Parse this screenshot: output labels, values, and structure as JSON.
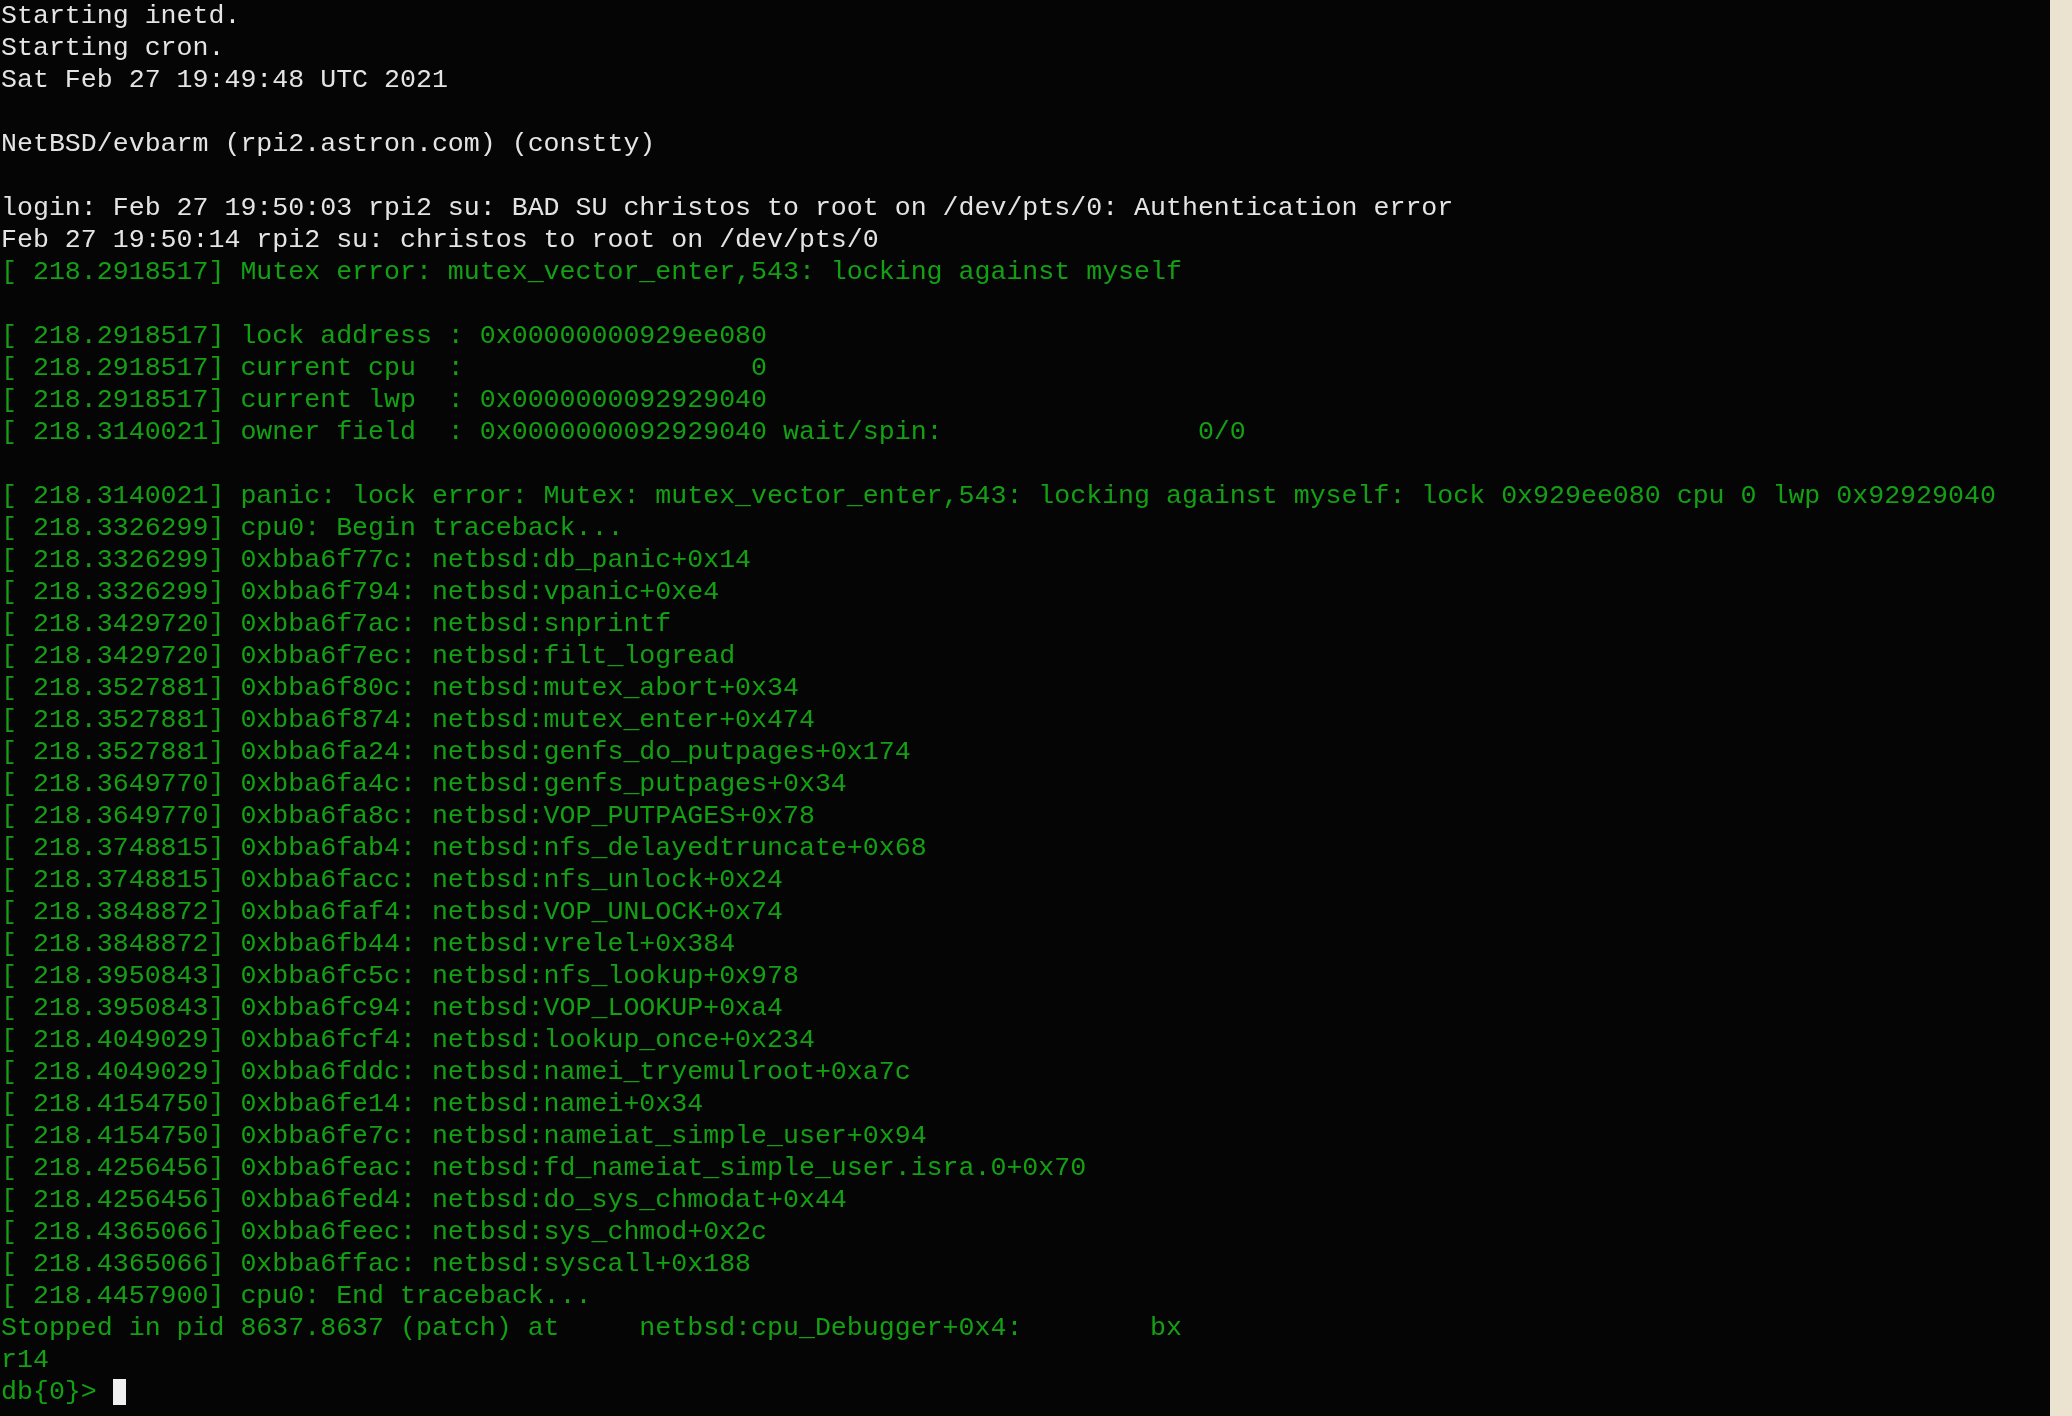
{
  "console": {
    "blocks": [
      {
        "lines": [
          {
            "kind": "system",
            "text": "Starting inetd."
          },
          {
            "kind": "system",
            "text": "Starting cron."
          },
          {
            "kind": "system",
            "text": "Sat Feb 27 19:49:48 UTC 2021"
          }
        ]
      },
      {
        "lines": [
          {
            "kind": "system",
            "text": "NetBSD/evbarm (rpi2.astron.com) (constty)"
          }
        ]
      },
      {
        "lines": [
          {
            "kind": "system",
            "text": "login: Feb 27 19:50:03 rpi2 su: BAD SU christos to root on /dev/pts/0: Authentication error"
          },
          {
            "kind": "system",
            "text": "Feb 27 19:50:14 rpi2 su: christos to root on /dev/pts/0"
          },
          {
            "kind": "kernel",
            "text": "[ 218.2918517] Mutex error: mutex_vector_enter,543: locking against myself"
          }
        ]
      },
      {
        "lines": [
          {
            "kind": "kernel",
            "text": "[ 218.2918517] lock address : 0x00000000929ee080"
          },
          {
            "kind": "kernel",
            "text": "[ 218.2918517] current cpu  :                  0"
          },
          {
            "kind": "kernel",
            "text": "[ 218.2918517] current lwp  : 0x0000000092929040"
          },
          {
            "kind": "kernel",
            "text": "[ 218.3140021] owner field  : 0x0000000092929040 wait/spin:                0/0"
          }
        ]
      },
      {
        "lines": [
          {
            "kind": "kernel",
            "text": "[ 218.3140021] panic: lock error: Mutex: mutex_vector_enter,543: locking against myself: lock 0x929ee080 cpu 0 lwp 0x92929040"
          },
          {
            "kind": "kernel",
            "text": "[ 218.3326299] cpu0: Begin traceback..."
          },
          {
            "kind": "kernel",
            "text": "[ 218.3326299] 0xbba6f77c: netbsd:db_panic+0x14"
          },
          {
            "kind": "kernel",
            "text": "[ 218.3326299] 0xbba6f794: netbsd:vpanic+0xe4"
          },
          {
            "kind": "kernel",
            "text": "[ 218.3429720] 0xbba6f7ac: netbsd:snprintf"
          },
          {
            "kind": "kernel",
            "text": "[ 218.3429720] 0xbba6f7ec: netbsd:filt_logread"
          },
          {
            "kind": "kernel",
            "text": "[ 218.3527881] 0xbba6f80c: netbsd:mutex_abort+0x34"
          },
          {
            "kind": "kernel",
            "text": "[ 218.3527881] 0xbba6f874: netbsd:mutex_enter+0x474"
          },
          {
            "kind": "kernel",
            "text": "[ 218.3527881] 0xbba6fa24: netbsd:genfs_do_putpages+0x174"
          },
          {
            "kind": "kernel",
            "text": "[ 218.3649770] 0xbba6fa4c: netbsd:genfs_putpages+0x34"
          },
          {
            "kind": "kernel",
            "text": "[ 218.3649770] 0xbba6fa8c: netbsd:VOP_PUTPAGES+0x78"
          },
          {
            "kind": "kernel",
            "text": "[ 218.3748815] 0xbba6fab4: netbsd:nfs_delayedtruncate+0x68"
          },
          {
            "kind": "kernel",
            "text": "[ 218.3748815] 0xbba6facc: netbsd:nfs_unlock+0x24"
          },
          {
            "kind": "kernel",
            "text": "[ 218.3848872] 0xbba6faf4: netbsd:VOP_UNLOCK+0x74"
          },
          {
            "kind": "kernel",
            "text": "[ 218.3848872] 0xbba6fb44: netbsd:vrelel+0x384"
          },
          {
            "kind": "kernel",
            "text": "[ 218.3950843] 0xbba6fc5c: netbsd:nfs_lookup+0x978"
          },
          {
            "kind": "kernel",
            "text": "[ 218.3950843] 0xbba6fc94: netbsd:VOP_LOOKUP+0xa4"
          },
          {
            "kind": "kernel",
            "text": "[ 218.4049029] 0xbba6fcf4: netbsd:lookup_once+0x234"
          },
          {
            "kind": "kernel",
            "text": "[ 218.4049029] 0xbba6fddc: netbsd:namei_tryemulroot+0xa7c"
          },
          {
            "kind": "kernel",
            "text": "[ 218.4154750] 0xbba6fe14: netbsd:namei+0x34"
          },
          {
            "kind": "kernel",
            "text": "[ 218.4154750] 0xbba6fe7c: netbsd:nameiat_simple_user+0x94"
          },
          {
            "kind": "kernel",
            "text": "[ 218.4256456] 0xbba6feac: netbsd:fd_nameiat_simple_user.isra.0+0x70"
          },
          {
            "kind": "kernel",
            "text": "[ 218.4256456] 0xbba6fed4: netbsd:do_sys_chmodat+0x44"
          },
          {
            "kind": "kernel",
            "text": "[ 218.4365066] 0xbba6feec: netbsd:sys_chmod+0x2c"
          },
          {
            "kind": "kernel",
            "text": "[ 218.4365066] 0xbba6ffac: netbsd:syscall+0x188"
          },
          {
            "kind": "kernel",
            "text": "[ 218.4457900] cpu0: End traceback..."
          },
          {
            "kind": "kernel",
            "text": "Stopped in pid 8637.8637 (patch) at     netbsd:cpu_Debugger+0x4:        bx"
          },
          {
            "kind": "kernel",
            "text": "r14"
          }
        ]
      }
    ],
    "prompt": {
      "text": "db{0}>"
    }
  }
}
